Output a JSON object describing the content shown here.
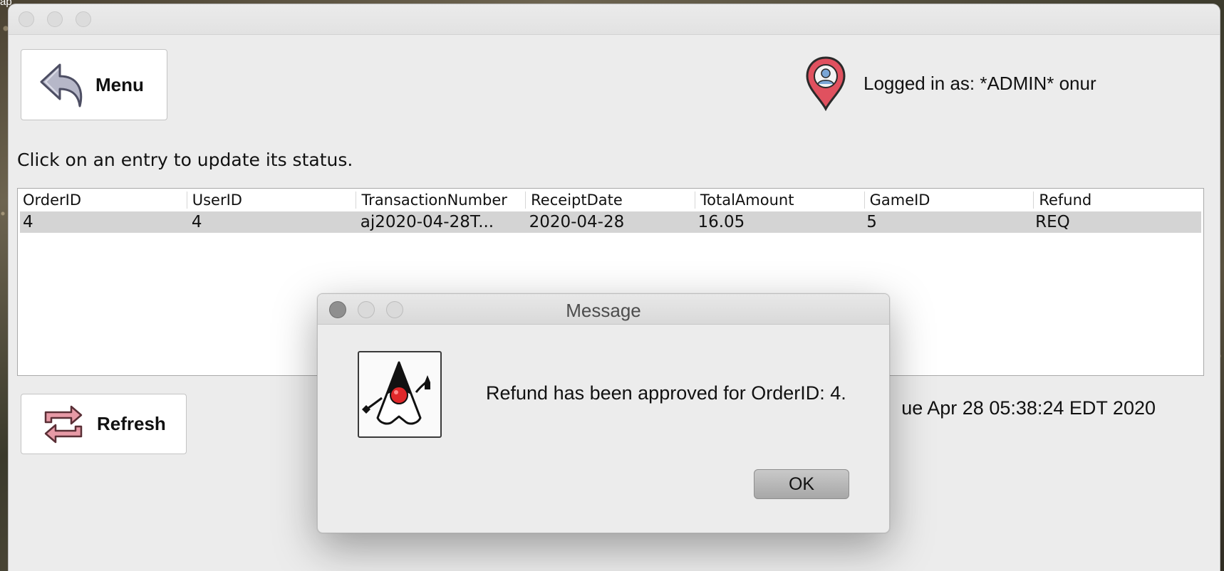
{
  "desktop": {
    "fragment_text": "ap"
  },
  "header": {
    "menu_button_label": "Menu",
    "user_label": "Logged in as: *ADMIN* onur"
  },
  "main": {
    "instructions": "Click on an entry to update its status.",
    "table": {
      "columns": [
        "OrderID",
        "UserID",
        "TransactionNumber",
        "ReceiptDate",
        "TotalAmount",
        "GameID",
        "Refund"
      ],
      "rows": [
        [
          "4",
          "4",
          "aj2020-04-28T...",
          "2020-04-28",
          "16.05",
          "5",
          "REQ"
        ]
      ]
    },
    "refresh_button_label": "Refresh",
    "timestamp": "ue Apr 28 05:38:24 EDT 2020"
  },
  "dialog": {
    "title": "Message",
    "message": "Refund has been approved for OrderID: 4.",
    "ok_label": "OK"
  },
  "colors": {
    "pin_red": "#e0515f",
    "refresh_pink": "#e79aa6",
    "duke_red": "#e0282a"
  }
}
